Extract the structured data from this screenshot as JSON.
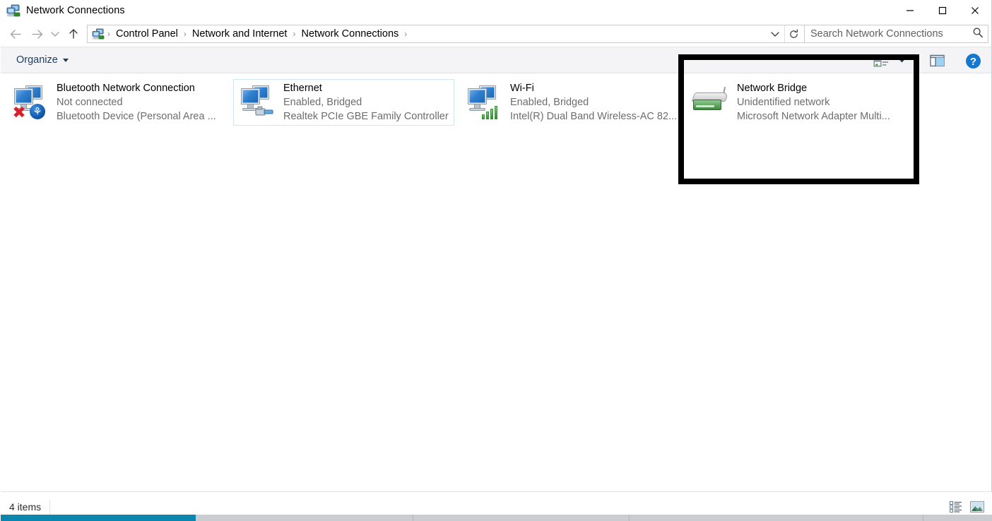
{
  "window": {
    "title": "Network Connections",
    "title_icon": "network-connections-icon",
    "minimize_label": "—",
    "maximize_label": "□",
    "close_label": "✕"
  },
  "navigation": {
    "back_label": "←",
    "forward_label": "→",
    "recent_label": "⌄",
    "up_label": "↑",
    "breadcrumb_icon": "network-connections-icon",
    "breadcrumbs": [
      {
        "label": "Control Panel"
      },
      {
        "label": "Network and Internet"
      },
      {
        "label": "Network Connections"
      }
    ],
    "separator": "›",
    "dropdown_label": "⌄",
    "refresh_label": "↻"
  },
  "search": {
    "placeholder": "Search Network Connections",
    "value": "",
    "icon": "search-icon"
  },
  "commandbar": {
    "organize_label": "Organize",
    "view_options_icon": "view-options-icon",
    "view_dropdown_icon": "chevron-down-icon",
    "preview_pane_icon": "preview-pane-icon",
    "help_icon": "help-icon",
    "help_label": "?"
  },
  "connections": [
    {
      "name": "Bluetooth Network Connection",
      "status": "Not connected",
      "device": "Bluetooth Device (Personal Area ...",
      "icon": "network-adapter-icon",
      "badge": "bluetooth-badge-icon",
      "disabled_badge": "red-x-icon",
      "selected": false,
      "focused": false
    },
    {
      "name": "Ethernet",
      "status": "Enabled, Bridged",
      "device": "Realtek PCIe GBE Family Controller",
      "icon": "network-adapter-icon",
      "badge": "ethernet-cable-badge-icon",
      "disabled_badge": "",
      "selected": false,
      "focused": true
    },
    {
      "name": "Wi-Fi",
      "status": "Enabled, Bridged",
      "device": "Intel(R) Dual Band Wireless-AC 82...",
      "icon": "network-adapter-icon",
      "badge": "wifi-signal-badge-icon",
      "disabled_badge": "",
      "selected": false,
      "focused": false
    },
    {
      "name": "Network Bridge",
      "status": "Unidentified network",
      "device": "Microsoft Network Adapter Multi...",
      "icon": "network-bridge-icon",
      "badge": "",
      "disabled_badge": "",
      "selected": false,
      "focused": false
    }
  ],
  "annotation": {
    "type": "highlight-rectangle",
    "color": "#000000",
    "target": "Network Bridge"
  },
  "statusbar": {
    "item_count": "4 items",
    "details_view_icon": "details-view-icon",
    "large_icons_view_icon": "large-icons-view-icon"
  },
  "colors": {
    "accent": "#0a85ad",
    "selection": "#cce8ff",
    "command_bar_bg": "#f4f4f6",
    "link": "#1f3a5f",
    "subtext": "#6d6d6d"
  }
}
